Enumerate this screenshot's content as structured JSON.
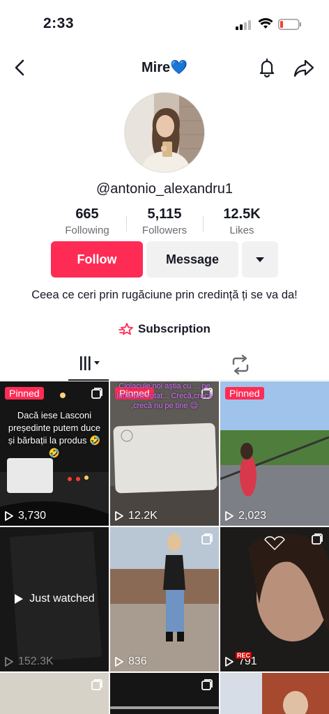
{
  "status": {
    "time": "2:33"
  },
  "header": {
    "title": "Mire💙"
  },
  "profile": {
    "username": "@antonio_alexandru1",
    "stats": [
      {
        "value": "665",
        "label": "Following"
      },
      {
        "value": "5,115",
        "label": "Followers"
      },
      {
        "value": "12.5K",
        "label": "Likes"
      }
    ],
    "follow_label": "Follow",
    "message_label": "Message",
    "bio": "Ceea ce ceri prin rugăciune prin credință ți se va da!",
    "subscription_label": "Subscription"
  },
  "videos": [
    {
      "pinned": "Pinned",
      "views": "3,730",
      "overlay": "Dacă iese Lasconi președinte putem duce și bărbații la produs 🤣🤣"
    },
    {
      "pinned": "Pinned",
      "views": "12.2K",
      "overlay": "Ciolacule,noi aștia cu ... pe lună am votat... Crecă,crecă ,crecă nu pe tine 😉"
    },
    {
      "pinned": "Pinned",
      "views": "2,023"
    },
    {
      "views": "152.3K",
      "status": "Just watched"
    },
    {
      "views": "836"
    },
    {
      "views": "791",
      "badge": "REC"
    }
  ],
  "colors": {
    "accent": "#fe2c55",
    "secondary_button": "#f1f1f2"
  }
}
